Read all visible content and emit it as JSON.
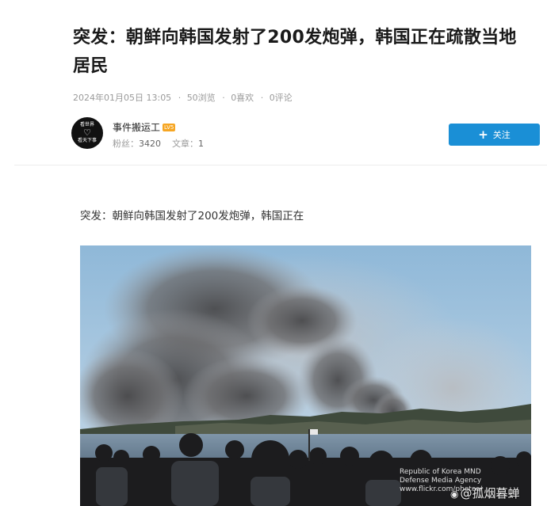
{
  "article": {
    "title": "突发：朝鲜向韩国发射了200发炮弹，韩国正在疏散当地居民",
    "date": "2024年01月05日 13:05",
    "views": "50浏览",
    "likes": "0喜欢",
    "comments": "0评论",
    "intro": "突发：朝鲜向韩国发射了200发炮弹，韩国正在"
  },
  "author": {
    "name": "事件搬运工",
    "level_badge": "LV5",
    "avatar_text_top": "看世界",
    "avatar_text_bottom": "看天下事",
    "fans_label": "粉丝：",
    "fans_value": "3420",
    "articles_label": "文章：",
    "articles_value": "1"
  },
  "follow_button": {
    "label": "关注",
    "icon": "plus-icon"
  },
  "photo": {
    "credit": "Republic of Korea MND\nDefense Media Agency\nwww.flickr.com/photos/",
    "watermark": "@孤烟暮蝉",
    "watermark_icon": "weibo-icon"
  },
  "colors": {
    "accent": "#1a8fd6",
    "badge": "#f6a623",
    "meta": "#9a9a9a"
  }
}
